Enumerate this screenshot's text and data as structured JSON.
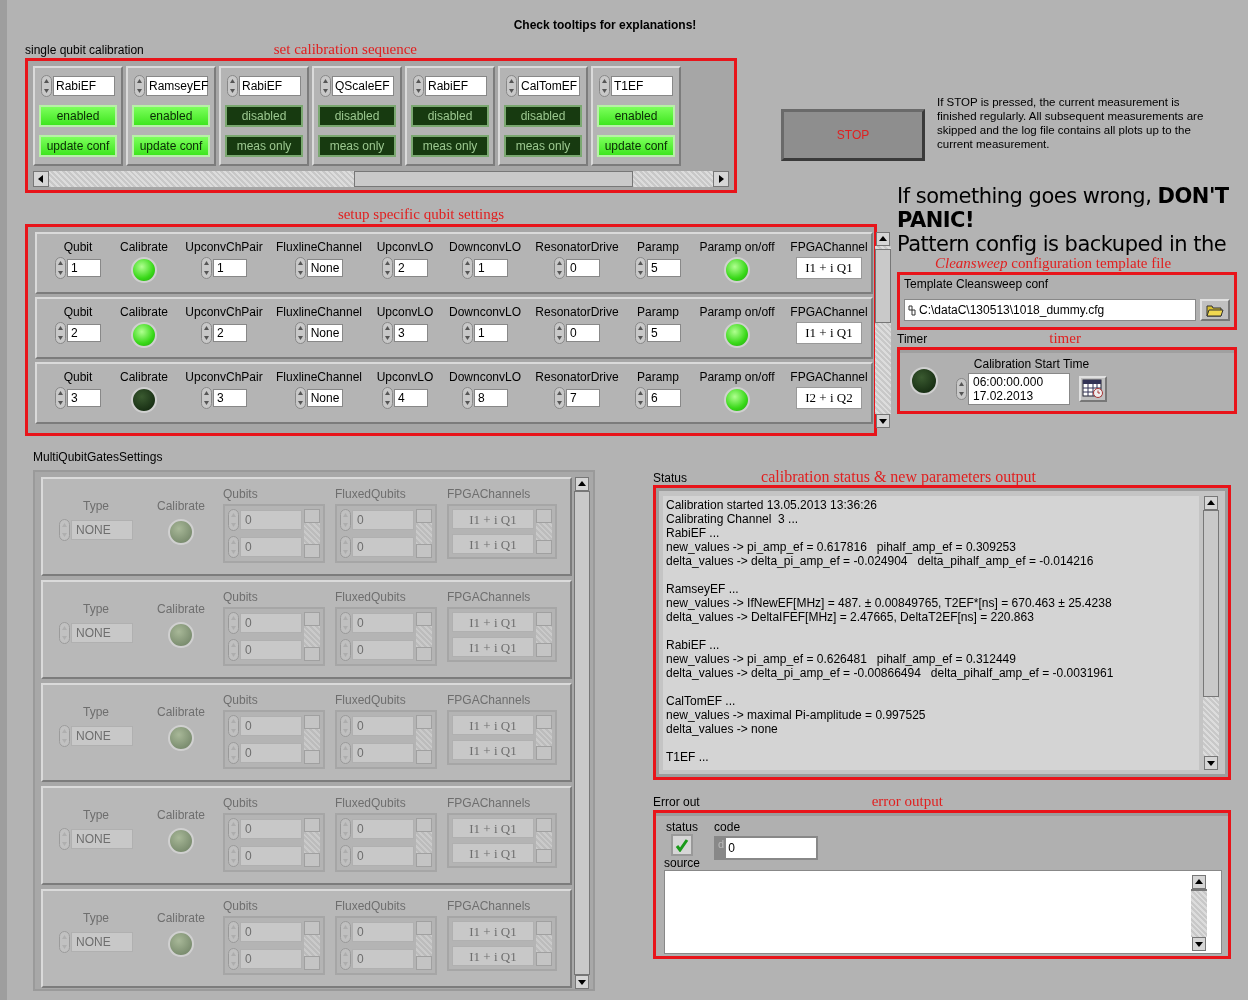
{
  "header": {
    "title": "Check tooltips for explanations!"
  },
  "sequence": {
    "label": "single qubit calibration",
    "annotation": "set calibration sequence",
    "steps": [
      {
        "name": "RabiEF",
        "on": true,
        "state": "enabled",
        "mode": "update conf"
      },
      {
        "name": "RamseyEF",
        "on": true,
        "state": "enabled",
        "mode": "update conf"
      },
      {
        "name": "RabiEF",
        "on": false,
        "state": "disabled",
        "mode": "meas only"
      },
      {
        "name": "QScaleEF",
        "on": false,
        "state": "disabled",
        "mode": "meas only"
      },
      {
        "name": "RabiEF",
        "on": false,
        "state": "disabled",
        "mode": "meas only"
      },
      {
        "name": "CalTomEF",
        "on": false,
        "state": "disabled",
        "mode": "meas only"
      },
      {
        "name": "T1EF",
        "on": true,
        "state": "enabled",
        "mode": "update conf"
      }
    ]
  },
  "stop": {
    "label": "STOP",
    "note": "If STOP is pressed, the current measurement is finished regularly. All subsequent measurements are skipped and the log file contains all plots up to the current measurement."
  },
  "qubit_settings": {
    "annotation": "setup specific qubit settings",
    "rows": [
      {
        "fields": [
          {
            "kind": "numeric",
            "label": "Qubit",
            "value": "1"
          },
          {
            "kind": "led",
            "label": "Calibrate",
            "on": true
          },
          {
            "kind": "numeric",
            "label": "UpconvChPair",
            "value": "1"
          },
          {
            "kind": "numeric",
            "label": "FluxlineChannel",
            "value": "None"
          },
          {
            "kind": "numeric",
            "label": "UpconvLO",
            "value": "2"
          },
          {
            "kind": "numeric",
            "label": "DownconvLO",
            "value": "1"
          },
          {
            "kind": "numeric",
            "label": "ResonatorDrive",
            "value": "0"
          },
          {
            "kind": "numeric",
            "label": "Paramp",
            "value": "5"
          },
          {
            "kind": "led",
            "label": "Paramp on/off",
            "on": true
          },
          {
            "kind": "display",
            "label": "FPGAChannel",
            "value": "I1 + i Q1"
          }
        ]
      },
      {
        "fields": [
          {
            "kind": "numeric",
            "label": "Qubit",
            "value": "2"
          },
          {
            "kind": "led",
            "label": "Calibrate",
            "on": true
          },
          {
            "kind": "numeric",
            "label": "UpconvChPair",
            "value": "2"
          },
          {
            "kind": "numeric",
            "label": "FluxlineChannel",
            "value": "None"
          },
          {
            "kind": "numeric",
            "label": "UpconvLO",
            "value": "3"
          },
          {
            "kind": "numeric",
            "label": "DownconvLO",
            "value": "1"
          },
          {
            "kind": "numeric",
            "label": "ResonatorDrive",
            "value": "0"
          },
          {
            "kind": "numeric",
            "label": "Paramp",
            "value": "5"
          },
          {
            "kind": "led",
            "label": "Paramp on/off",
            "on": true
          },
          {
            "kind": "display",
            "label": "FPGAChannel",
            "value": "I1 + i Q1"
          }
        ]
      },
      {
        "fields": [
          {
            "kind": "numeric",
            "label": "Qubit",
            "value": "3"
          },
          {
            "kind": "led",
            "label": "Calibrate",
            "on": false
          },
          {
            "kind": "numeric",
            "label": "UpconvChPair",
            "value": "3"
          },
          {
            "kind": "numeric",
            "label": "FluxlineChannel",
            "value": "None"
          },
          {
            "kind": "numeric",
            "label": "UpconvLO",
            "value": "4"
          },
          {
            "kind": "numeric",
            "label": "DownconvLO",
            "value": "8"
          },
          {
            "kind": "numeric",
            "label": "ResonatorDrive",
            "value": "7"
          },
          {
            "kind": "numeric",
            "label": "Paramp",
            "value": "6"
          },
          {
            "kind": "led",
            "label": "Paramp on/off",
            "on": true
          },
          {
            "kind": "display",
            "label": "FPGAChannel",
            "value": "I2 + i Q2"
          }
        ]
      }
    ]
  },
  "notice": {
    "headline": "If something goes wrong, **DON'T PANIC!**",
    "line": "Pattern config is backuped in the"
  },
  "template": {
    "annotation": "*Cleansweep* configuration template file",
    "label": "Template Cleansweep conf",
    "path": "C:\\dataC\\130513\\1018_dummy.cfg"
  },
  "timer": {
    "label": "Timer",
    "annotation": "timer",
    "led_on": false,
    "field_label": "Calibration Start Time",
    "time": "06:00:00.000",
    "date": "17.02.2013"
  },
  "multi_qubit": {
    "label": "MultiQubitGatesSettings",
    "gates": [
      {
        "disabled": true,
        "labels": [
          "Type",
          "Calibrate",
          "Qubits",
          "FluxedQubits",
          "FPGAChannels"
        ],
        "type": "NONE",
        "calibrate_on": false,
        "qubits": [
          "0",
          "0"
        ],
        "fluxed_qubits": [
          "0",
          "0"
        ],
        "fpga_channels": [
          "I1 + i Q1",
          "I1 + i Q1"
        ]
      },
      {
        "disabled": true,
        "labels": [
          "Type",
          "Calibrate",
          "Qubits",
          "FluxedQubits",
          "FPGAChannels"
        ],
        "type": "NONE",
        "calibrate_on": false,
        "qubits": [
          "0",
          "0"
        ],
        "fluxed_qubits": [
          "0",
          "0"
        ],
        "fpga_channels": [
          "I1 + i Q1",
          "I1 + i Q1"
        ]
      },
      {
        "disabled": true,
        "labels": [
          "Type",
          "Calibrate",
          "Qubits",
          "FluxedQubits",
          "FPGAChannels"
        ],
        "type": "NONE",
        "calibrate_on": false,
        "qubits": [
          "0",
          "0"
        ],
        "fluxed_qubits": [
          "0",
          "0"
        ],
        "fpga_channels": [
          "I1 + i Q1",
          "I1 + i Q1"
        ]
      },
      {
        "disabled": true,
        "labels": [
          "Type",
          "Calibrate",
          "Qubits",
          "FluxedQubits",
          "FPGAChannels"
        ],
        "type": "NONE",
        "calibrate_on": false,
        "qubits": [
          "0",
          "0"
        ],
        "fluxed_qubits": [
          "0",
          "0"
        ],
        "fpga_channels": [
          "I1 + i Q1",
          "I1 + i Q1"
        ]
      },
      {
        "disabled": true,
        "labels": [
          "Type",
          "Calibrate",
          "Qubits",
          "FluxedQubits",
          "FPGAChannels"
        ],
        "type": "NONE",
        "calibrate_on": false,
        "qubits": [
          "0",
          "0"
        ],
        "fluxed_qubits": [
          "0",
          "0"
        ],
        "fpga_channels": [
          "I1 + i Q1",
          "I1 + i Q1"
        ]
      }
    ]
  },
  "status": {
    "label": "Status",
    "annotation": "calibration status & new parameters output",
    "blocks": [
      [
        "Calibration started 13.05.2013 13:36:26",
        "Calibrating Channel  3 ...",
        "RabiEF ...",
        "new_values -> pi_amp_ef = 0.617816   pihalf_amp_ef = 0.309253",
        "delta_values -> delta_pi_amp_ef = -0.024904   delta_pihalf_amp_ef = -0.014216"
      ],
      [
        "RamseyEF ...",
        "new_values -> IfNewEF[MHz] = 487. ± 0.00849765, T2EF*[ns] = 670.463 ± 25.4238",
        "delta_values -> DeltaIFEF[MHz] = 2.47665, DeltaT2EF[ns] = 220.863"
      ],
      [
        "RabiEF ...",
        "new_values -> pi_amp_ef = 0.626481   pihalf_amp_ef = 0.312449",
        "delta_values -> delta_pi_amp_ef = -0.00866494   delta_pihalf_amp_ef = -0.0031961"
      ],
      [
        "CalTomEF ...",
        "new_values -> maximal Pi-amplitude = 0.997525",
        "delta_values -> none"
      ],
      [
        "T1EF ..."
      ]
    ]
  },
  "error_out": {
    "label": "Error out",
    "annotation": "error output",
    "status_label": "status",
    "status_ok": true,
    "code_label": "code",
    "radix": "d",
    "code": "0",
    "source_label": "source"
  }
}
